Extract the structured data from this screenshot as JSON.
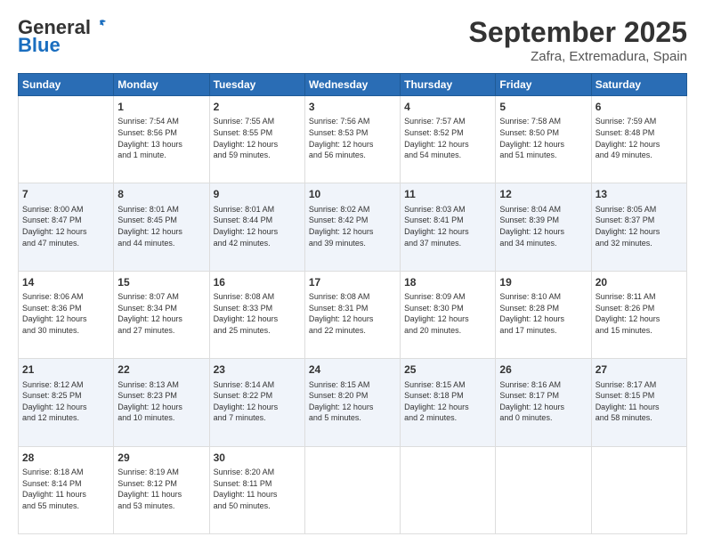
{
  "header": {
    "logo_general": "General",
    "logo_blue": "Blue",
    "month": "September 2025",
    "location": "Zafra, Extremadura, Spain"
  },
  "weekdays": [
    "Sunday",
    "Monday",
    "Tuesday",
    "Wednesday",
    "Thursday",
    "Friday",
    "Saturday"
  ],
  "weeks": [
    [
      {
        "day": "",
        "info": ""
      },
      {
        "day": "1",
        "info": "Sunrise: 7:54 AM\nSunset: 8:56 PM\nDaylight: 13 hours\nand 1 minute."
      },
      {
        "day": "2",
        "info": "Sunrise: 7:55 AM\nSunset: 8:55 PM\nDaylight: 12 hours\nand 59 minutes."
      },
      {
        "day": "3",
        "info": "Sunrise: 7:56 AM\nSunset: 8:53 PM\nDaylight: 12 hours\nand 56 minutes."
      },
      {
        "day": "4",
        "info": "Sunrise: 7:57 AM\nSunset: 8:52 PM\nDaylight: 12 hours\nand 54 minutes."
      },
      {
        "day": "5",
        "info": "Sunrise: 7:58 AM\nSunset: 8:50 PM\nDaylight: 12 hours\nand 51 minutes."
      },
      {
        "day": "6",
        "info": "Sunrise: 7:59 AM\nSunset: 8:48 PM\nDaylight: 12 hours\nand 49 minutes."
      }
    ],
    [
      {
        "day": "7",
        "info": "Sunrise: 8:00 AM\nSunset: 8:47 PM\nDaylight: 12 hours\nand 47 minutes."
      },
      {
        "day": "8",
        "info": "Sunrise: 8:01 AM\nSunset: 8:45 PM\nDaylight: 12 hours\nand 44 minutes."
      },
      {
        "day": "9",
        "info": "Sunrise: 8:01 AM\nSunset: 8:44 PM\nDaylight: 12 hours\nand 42 minutes."
      },
      {
        "day": "10",
        "info": "Sunrise: 8:02 AM\nSunset: 8:42 PM\nDaylight: 12 hours\nand 39 minutes."
      },
      {
        "day": "11",
        "info": "Sunrise: 8:03 AM\nSunset: 8:41 PM\nDaylight: 12 hours\nand 37 minutes."
      },
      {
        "day": "12",
        "info": "Sunrise: 8:04 AM\nSunset: 8:39 PM\nDaylight: 12 hours\nand 34 minutes."
      },
      {
        "day": "13",
        "info": "Sunrise: 8:05 AM\nSunset: 8:37 PM\nDaylight: 12 hours\nand 32 minutes."
      }
    ],
    [
      {
        "day": "14",
        "info": "Sunrise: 8:06 AM\nSunset: 8:36 PM\nDaylight: 12 hours\nand 30 minutes."
      },
      {
        "day": "15",
        "info": "Sunrise: 8:07 AM\nSunset: 8:34 PM\nDaylight: 12 hours\nand 27 minutes."
      },
      {
        "day": "16",
        "info": "Sunrise: 8:08 AM\nSunset: 8:33 PM\nDaylight: 12 hours\nand 25 minutes."
      },
      {
        "day": "17",
        "info": "Sunrise: 8:08 AM\nSunset: 8:31 PM\nDaylight: 12 hours\nand 22 minutes."
      },
      {
        "day": "18",
        "info": "Sunrise: 8:09 AM\nSunset: 8:30 PM\nDaylight: 12 hours\nand 20 minutes."
      },
      {
        "day": "19",
        "info": "Sunrise: 8:10 AM\nSunset: 8:28 PM\nDaylight: 12 hours\nand 17 minutes."
      },
      {
        "day": "20",
        "info": "Sunrise: 8:11 AM\nSunset: 8:26 PM\nDaylight: 12 hours\nand 15 minutes."
      }
    ],
    [
      {
        "day": "21",
        "info": "Sunrise: 8:12 AM\nSunset: 8:25 PM\nDaylight: 12 hours\nand 12 minutes."
      },
      {
        "day": "22",
        "info": "Sunrise: 8:13 AM\nSunset: 8:23 PM\nDaylight: 12 hours\nand 10 minutes."
      },
      {
        "day": "23",
        "info": "Sunrise: 8:14 AM\nSunset: 8:22 PM\nDaylight: 12 hours\nand 7 minutes."
      },
      {
        "day": "24",
        "info": "Sunrise: 8:15 AM\nSunset: 8:20 PM\nDaylight: 12 hours\nand 5 minutes."
      },
      {
        "day": "25",
        "info": "Sunrise: 8:15 AM\nSunset: 8:18 PM\nDaylight: 12 hours\nand 2 minutes."
      },
      {
        "day": "26",
        "info": "Sunrise: 8:16 AM\nSunset: 8:17 PM\nDaylight: 12 hours\nand 0 minutes."
      },
      {
        "day": "27",
        "info": "Sunrise: 8:17 AM\nSunset: 8:15 PM\nDaylight: 11 hours\nand 58 minutes."
      }
    ],
    [
      {
        "day": "28",
        "info": "Sunrise: 8:18 AM\nSunset: 8:14 PM\nDaylight: 11 hours\nand 55 minutes."
      },
      {
        "day": "29",
        "info": "Sunrise: 8:19 AM\nSunset: 8:12 PM\nDaylight: 11 hours\nand 53 minutes."
      },
      {
        "day": "30",
        "info": "Sunrise: 8:20 AM\nSunset: 8:11 PM\nDaylight: 11 hours\nand 50 minutes."
      },
      {
        "day": "",
        "info": ""
      },
      {
        "day": "",
        "info": ""
      },
      {
        "day": "",
        "info": ""
      },
      {
        "day": "",
        "info": ""
      }
    ]
  ]
}
